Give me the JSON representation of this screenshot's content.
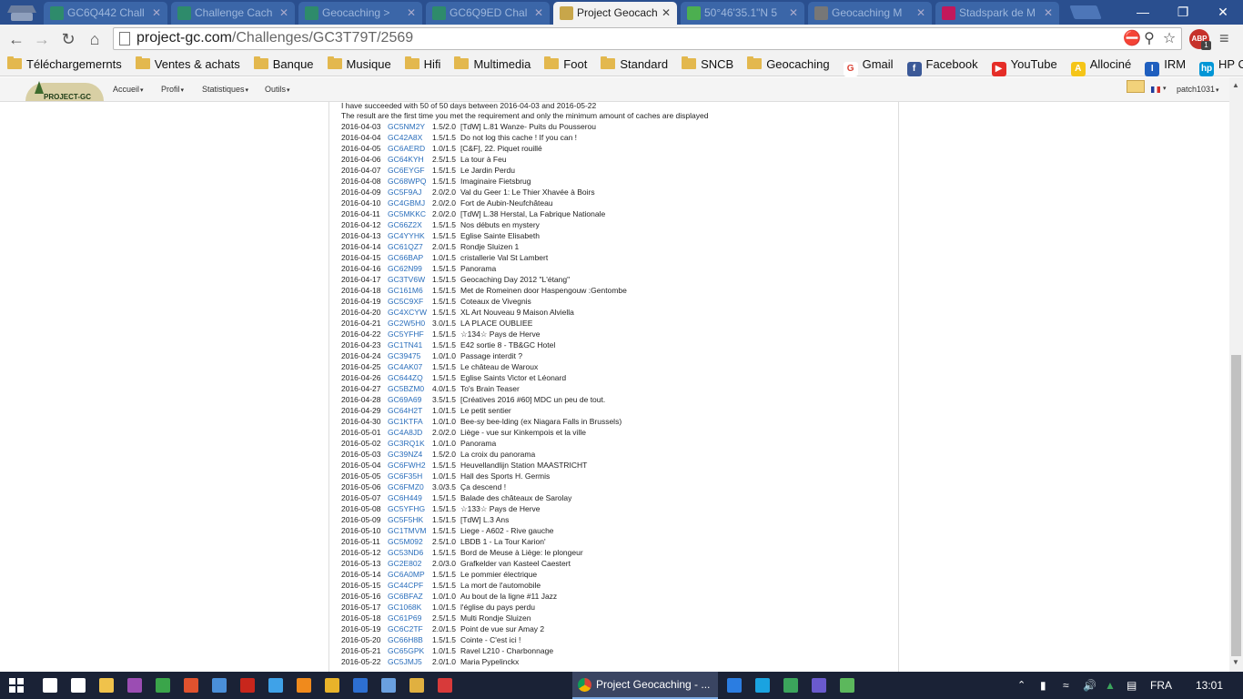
{
  "browser": {
    "tabs": [
      {
        "title": "GC6Q442 Chall",
        "color": "#2e8b6b",
        "active": false
      },
      {
        "title": "Challenge Cach",
        "color": "#2e8b6b",
        "active": false
      },
      {
        "title": "Geocaching > ",
        "color": "#2e8b6b",
        "active": false
      },
      {
        "title": "GC6Q9ED Chal",
        "color": "#2e8b6b",
        "active": false
      },
      {
        "title": "Project Geocach",
        "color": "#c8a64a",
        "active": true
      },
      {
        "title": "50°46'35.1\"N 5",
        "color": "#4caf50",
        "active": false
      },
      {
        "title": "Geocaching M",
        "color": "#777777",
        "active": false
      },
      {
        "title": "Stadspark de M",
        "color": "#c2185b",
        "active": false
      }
    ],
    "window_buttons": {
      "minimize": "—",
      "restore": "❐",
      "close": "✕"
    },
    "url_host": "project-gc.com",
    "url_path": "/Challenges/GC3T79T/2569",
    "abp_label": "ABP",
    "abp_count": "1"
  },
  "bookmarks": [
    {
      "label": "Téléchargemernts",
      "type": "folder"
    },
    {
      "label": "Ventes & achats",
      "type": "folder"
    },
    {
      "label": "Banque",
      "type": "folder"
    },
    {
      "label": "Musique",
      "type": "folder"
    },
    {
      "label": "Hifi",
      "type": "folder"
    },
    {
      "label": "Multimedia",
      "type": "folder"
    },
    {
      "label": "Foot",
      "type": "folder"
    },
    {
      "label": "Standard",
      "type": "folder"
    },
    {
      "label": "SNCB",
      "type": "folder"
    },
    {
      "label": "Geocaching",
      "type": "folder"
    },
    {
      "label": "Gmail",
      "type": "site",
      "color": "#ffffff",
      "glyph": "G"
    },
    {
      "label": "Facebook",
      "type": "site",
      "color": "#3b5998",
      "glyph": "f"
    },
    {
      "label": "YouTube",
      "type": "site",
      "color": "#e52d27",
      "glyph": "▶"
    },
    {
      "label": "Allociné",
      "type": "site",
      "color": "#f5c518",
      "glyph": "A"
    },
    {
      "label": "IRM",
      "type": "site",
      "color": "#1f5fbf",
      "glyph": "I"
    },
    {
      "label": "HP Connected",
      "type": "site",
      "color": "#0096d6",
      "glyph": "hp"
    }
  ],
  "site_header": {
    "logo_text": "PROJECT-GC",
    "menu": [
      "Accueil",
      "Profil",
      "Statistiques",
      "Outils"
    ],
    "username": "patch1031"
  },
  "results": {
    "summary": "I have succeeded with 50 of 50 days between 2016-04-03 and 2016-05-22",
    "note": "The result are the first time you met the requirement and only the minimum amount of caches are displayed",
    "rows": [
      {
        "date": "2016-04-03",
        "gc": "GC5NM2Y",
        "dt": "1.5/2.0",
        "name": "[TdW] L.81 Wanze- Puits du Pousserou"
      },
      {
        "date": "2016-04-04",
        "gc": "GC42A8X",
        "dt": "1.5/1.5",
        "name": "Do not log this cache ! If you can !"
      },
      {
        "date": "2016-04-05",
        "gc": "GC6AERD",
        "dt": "1.0/1.5",
        "name": "[C&F], 22. Piquet rouillé"
      },
      {
        "date": "2016-04-06",
        "gc": "GC64KYH",
        "dt": "2.5/1.5",
        "name": "La tour à Feu"
      },
      {
        "date": "2016-04-07",
        "gc": "GC6EYGF",
        "dt": "1.5/1.5",
        "name": "Le Jardin Perdu"
      },
      {
        "date": "2016-04-08",
        "gc": "GC68WPQ",
        "dt": "1.5/1.5",
        "name": "Imaginaire Fietsbrug"
      },
      {
        "date": "2016-04-09",
        "gc": "GC5F9AJ",
        "dt": "2.0/2.0",
        "name": "Val du Geer 1: Le Thier Xhavée à Boirs"
      },
      {
        "date": "2016-04-10",
        "gc": "GC4GBMJ",
        "dt": "2.0/2.0",
        "name": "Fort de Aubin-Neufchâteau"
      },
      {
        "date": "2016-04-11",
        "gc": "GC5MKKC",
        "dt": "2.0/2.0",
        "name": "[TdW] L.38 Herstal, La Fabrique Nationale"
      },
      {
        "date": "2016-04-12",
        "gc": "GC66Z2X",
        "dt": "1.5/1.5",
        "name": "Nos débuts en mystery"
      },
      {
        "date": "2016-04-13",
        "gc": "GC4YYHK",
        "dt": "1.5/1.5",
        "name": "Eglise Sainte Elisabeth"
      },
      {
        "date": "2016-04-14",
        "gc": "GC61QZ7",
        "dt": "2.0/1.5",
        "name": "Rondje Sluizen 1"
      },
      {
        "date": "2016-04-15",
        "gc": "GC66BAP",
        "dt": "1.0/1.5",
        "name": "cristallerie Val St Lambert"
      },
      {
        "date": "2016-04-16",
        "gc": "GC62N99",
        "dt": "1.5/1.5",
        "name": "Panorama"
      },
      {
        "date": "2016-04-17",
        "gc": "GC3TV6W",
        "dt": "1.5/1.5",
        "name": "Geocaching Day 2012 \"L'étang\""
      },
      {
        "date": "2016-04-18",
        "gc": "GC161M6",
        "dt": "1.5/1.5",
        "name": "Met de Romeinen door Haspengouw :Gentombe"
      },
      {
        "date": "2016-04-19",
        "gc": "GC5C9XF",
        "dt": "1.5/1.5",
        "name": "Coteaux de Vivegnis"
      },
      {
        "date": "2016-04-20",
        "gc": "GC4XCYW",
        "dt": "1.5/1.5",
        "name": "XL Art Nouveau 9 Maison Alviella"
      },
      {
        "date": "2016-04-21",
        "gc": "GC2W5H0",
        "dt": "3.0/1.5",
        "name": "LA PLACE OUBLIEE"
      },
      {
        "date": "2016-04-22",
        "gc": "GC5YFHF",
        "dt": "1.5/1.5",
        "name": "☆134☆ Pays de Herve"
      },
      {
        "date": "2016-04-23",
        "gc": "GC1TN41",
        "dt": "1.5/1.5",
        "name": "E42 sortie 8 - TB&GC Hotel"
      },
      {
        "date": "2016-04-24",
        "gc": "GC39475",
        "dt": "1.0/1.0",
        "name": "Passage interdit ?"
      },
      {
        "date": "2016-04-25",
        "gc": "GC4AK07",
        "dt": "1.5/1.5",
        "name": "Le château de Waroux"
      },
      {
        "date": "2016-04-26",
        "gc": "GC644ZQ",
        "dt": "1.5/1.5",
        "name": "Eglise Saints Victor et Léonard"
      },
      {
        "date": "2016-04-27",
        "gc": "GC5BZM0",
        "dt": "4.0/1.5",
        "name": "To's Brain Teaser"
      },
      {
        "date": "2016-04-28",
        "gc": "GC69A69",
        "dt": "3.5/1.5",
        "name": "[Créatives 2016 #60] MDC un peu de tout."
      },
      {
        "date": "2016-04-29",
        "gc": "GC64H2T",
        "dt": "1.0/1.5",
        "name": "Le petit sentier"
      },
      {
        "date": "2016-04-30",
        "gc": "GC1KTFA",
        "dt": "1.0/1.0",
        "name": "Bee-sy bee-lding (ex Niagara Falls in Brussels)"
      },
      {
        "date": "2016-05-01",
        "gc": "GC4A8JD",
        "dt": "2.0/2.0",
        "name": "Liège - vue sur Kinkempois et la ville"
      },
      {
        "date": "2016-05-02",
        "gc": "GC3RQ1K",
        "dt": "1.0/1.0",
        "name": "Panorama"
      },
      {
        "date": "2016-05-03",
        "gc": "GC39NZ4",
        "dt": "1.5/2.0",
        "name": "La croix du panorama"
      },
      {
        "date": "2016-05-04",
        "gc": "GC6FWH2",
        "dt": "1.5/1.5",
        "name": "Heuvellandlijn Station MAASTRICHT"
      },
      {
        "date": "2016-05-05",
        "gc": "GC6F35H",
        "dt": "1.0/1.5",
        "name": "Hall des Sports H. Germis"
      },
      {
        "date": "2016-05-06",
        "gc": "GC6FMZ0",
        "dt": "3.0/3.5",
        "name": "Ça descend !"
      },
      {
        "date": "2016-05-07",
        "gc": "GC6H449",
        "dt": "1.5/1.5",
        "name": "Balade des châteaux de Sarolay"
      },
      {
        "date": "2016-05-08",
        "gc": "GC5YFHG",
        "dt": "1.5/1.5",
        "name": "☆133☆ Pays de Herve"
      },
      {
        "date": "2016-05-09",
        "gc": "GC5F5HK",
        "dt": "1.5/1.5",
        "name": "[TdW] L.3 Ans"
      },
      {
        "date": "2016-05-10",
        "gc": "GC1TMVM",
        "dt": "1.5/1.5",
        "name": "Liege - A602 - Rive gauche"
      },
      {
        "date": "2016-05-11",
        "gc": "GC5M092",
        "dt": "2.5/1.0",
        "name": "LBDB 1 - La Tour Karion'"
      },
      {
        "date": "2016-05-12",
        "gc": "GC53ND6",
        "dt": "1.5/1.5",
        "name": "Bord de Meuse à Liège: le plongeur"
      },
      {
        "date": "2016-05-13",
        "gc": "GC2E802",
        "dt": "2.0/3.0",
        "name": "Grafkelder van Kasteel Caestert"
      },
      {
        "date": "2016-05-14",
        "gc": "GC6A0MP",
        "dt": "1.5/1.5",
        "name": "Le pommier électrique"
      },
      {
        "date": "2016-05-15",
        "gc": "GC44CPF",
        "dt": "1.5/1.5",
        "name": "La mort de l'automobile"
      },
      {
        "date": "2016-05-16",
        "gc": "GC6BFAZ",
        "dt": "1.0/1.0",
        "name": "Au bout de la ligne #11 Jazz"
      },
      {
        "date": "2016-05-17",
        "gc": "GC1068K",
        "dt": "1.0/1.5",
        "name": "l'église du pays perdu"
      },
      {
        "date": "2016-05-18",
        "gc": "GC61P69",
        "dt": "2.5/1.5",
        "name": "Multi Rondje Sluizen"
      },
      {
        "date": "2016-05-19",
        "gc": "GC6C2TF",
        "dt": "2.0/1.5",
        "name": "Point de vue sur Amay 2"
      },
      {
        "date": "2016-05-20",
        "gc": "GC66H8B",
        "dt": "1.5/1.5",
        "name": "Cointe - C'est ici !"
      },
      {
        "date": "2016-05-21",
        "gc": "GC65GPK",
        "dt": "1.0/1.5",
        "name": "Ravel L210 - Charbonnage"
      },
      {
        "date": "2016-05-22",
        "gc": "GC5JMJ5",
        "dt": "2.0/1.0",
        "name": "Maria Pypelinckx"
      }
    ]
  },
  "taskbar": {
    "active_app": "Project Geocaching - ...",
    "language": "FRA",
    "time": "13:01",
    "icons": [
      {
        "name": "search-icon",
        "color": "#ffffff"
      },
      {
        "name": "task-view-icon",
        "color": "#ffffff"
      },
      {
        "name": "file-explorer-icon",
        "color": "#f0c24b"
      },
      {
        "name": "winrar-icon",
        "color": "#9b4db3"
      },
      {
        "name": "app-green-icon",
        "color": "#3aa54a"
      },
      {
        "name": "app-red-icon",
        "color": "#e0522e"
      },
      {
        "name": "photos-icon",
        "color": "#4a8fd9"
      },
      {
        "name": "acrobat-icon",
        "color": "#c8261c"
      },
      {
        "name": "firefox-icon",
        "color": "#3fa2e8"
      },
      {
        "name": "vlc-icon",
        "color": "#f08a1c"
      },
      {
        "name": "app-yellow-icon",
        "color": "#e8b32a"
      },
      {
        "name": "app-blue-icon",
        "color": "#2d6fd1"
      },
      {
        "name": "settings-icon",
        "color": "#6aa0e0"
      },
      {
        "name": "app-v-icon",
        "color": "#e0b040"
      },
      {
        "name": "app-red2-icon",
        "color": "#d83a3a"
      }
    ],
    "icons_after": [
      {
        "name": "edge-icon",
        "color": "#2b7de1"
      },
      {
        "name": "skype-icon",
        "color": "#1aa3e0"
      },
      {
        "name": "drive-icon",
        "color": "#3ba55c"
      },
      {
        "name": "download-icon",
        "color": "#6a5acd"
      },
      {
        "name": "utorrent-icon",
        "color": "#5cb85c"
      }
    ]
  }
}
